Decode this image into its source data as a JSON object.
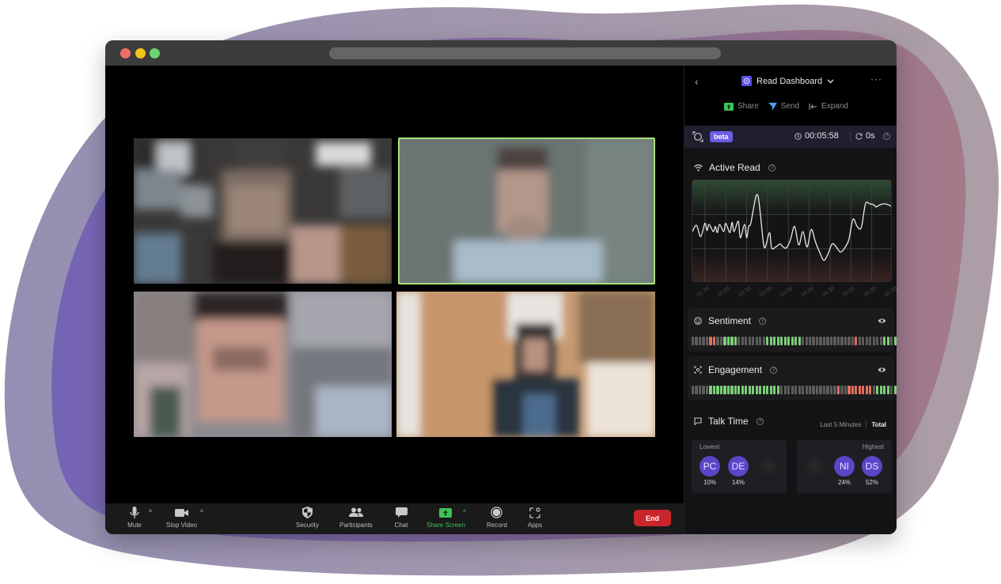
{
  "window": {
    "traffic_lights": [
      "close",
      "minimize",
      "maximize"
    ],
    "colors": {
      "close": "#ec7062",
      "minimize": "#f0c419",
      "maximize": "#6cd371"
    }
  },
  "meeting": {
    "tiles": [
      {
        "id": "participant-1",
        "active_speaker": false
      },
      {
        "id": "participant-2",
        "active_speaker": true
      },
      {
        "id": "participant-3",
        "active_speaker": false
      },
      {
        "id": "participant-4",
        "active_speaker": false
      }
    ],
    "active_speaker_color": "#a7e07b",
    "toolbar": {
      "mute": "Mute",
      "stop_video": "Stop Video",
      "security": "Security",
      "participants": "Participants",
      "chat": "Chat",
      "share_screen": "Share Screen",
      "record": "Record",
      "apps": "Apps",
      "end": "End",
      "caret": "^"
    }
  },
  "panel": {
    "back": "‹",
    "title": "Read Dashboard",
    "more": "···",
    "actions": {
      "share": "Share",
      "send": "Send",
      "expand": "Expand"
    },
    "status": {
      "badge": "beta",
      "elapsed": "00:05:58",
      "delay": "0s",
      "help": "?"
    },
    "active_read": {
      "title": "Active Read",
      "help": "?"
    },
    "sentiment": {
      "title": "Sentiment",
      "help": "?",
      "segments": "nnnnnrrnnggggnnnnnnnnggggggggggnnnnnnnnnnnnnnnrnnnnnnnggnggggg"
    },
    "engagement": {
      "title": "Engagement",
      "help": "?",
      "segments": "nnnnnggggggggggggggggggggnnnnnnnnnnnnnnnnrnnrrrrrrrnggggnggggg"
    },
    "talk_time": {
      "title": "Talk Time",
      "help": "?",
      "toggle": {
        "last5": "Last 5 Minutes",
        "total": "Total"
      },
      "lowest_label": "Lowest",
      "highest_label": "Highest",
      "lowest": [
        {
          "initials": "PC",
          "percent": "10%"
        },
        {
          "initials": "DE",
          "percent": "14%"
        }
      ],
      "highest": [
        {
          "initials": "NI",
          "percent": "24%"
        },
        {
          "initials": "DS",
          "percent": "52%"
        }
      ]
    }
  },
  "chart_data": {
    "type": "line",
    "title": "Active Read",
    "xlabel": "",
    "ylabel": "",
    "x_tick_labels": [
      "01:30",
      "02:00",
      "02:30",
      "03:00",
      "03:30",
      "04:00",
      "04:30",
      "05:00",
      "05:30",
      "06:00"
    ],
    "ylim": [
      0,
      100
    ],
    "grid": true,
    "series": [
      {
        "name": "Active Read",
        "x_minutes": [
          1.2,
          1.3,
          1.4,
          1.5,
          1.55,
          1.6,
          1.7,
          1.75,
          1.8,
          1.85,
          1.95,
          2.0,
          2.1,
          2.15,
          2.2,
          2.3,
          2.35,
          2.45,
          2.5,
          2.55,
          2.6,
          2.7,
          2.75,
          2.8,
          2.9,
          2.95,
          3.05,
          3.1,
          3.2,
          3.3,
          3.35,
          3.45,
          3.55,
          3.65,
          3.75,
          3.85,
          3.95,
          4.05,
          4.15,
          4.25,
          4.35,
          4.45,
          4.55,
          4.65,
          4.75,
          4.85,
          4.95,
          5.05,
          5.15,
          5.25,
          5.35,
          5.45,
          5.55,
          5.6,
          5.7,
          5.8,
          5.9,
          6.0
        ],
        "values": [
          50,
          56,
          45,
          58,
          51,
          57,
          50,
          55,
          49,
          57,
          50,
          58,
          49,
          59,
          50,
          60,
          44,
          57,
          44,
          55,
          58,
          80,
          86,
          78,
          40,
          35,
          49,
          34,
          35,
          38,
          36,
          34,
          42,
          55,
          37,
          50,
          35,
          52,
          40,
          30,
          22,
          28,
          38,
          35,
          30,
          34,
          42,
          62,
          55,
          54,
          77,
          77,
          76,
          74,
          76,
          77,
          76,
          74
        ]
      }
    ]
  }
}
